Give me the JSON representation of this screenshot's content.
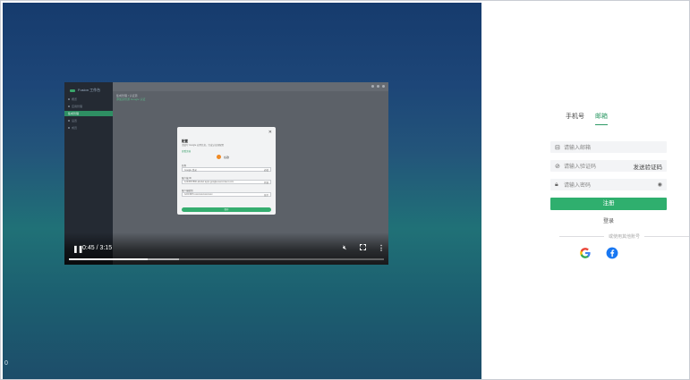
{
  "hero": {
    "corner_text": "0",
    "video": {
      "sidebar": {
        "logo": "Fusion 工作台",
        "items": [
          {
            "label": "概览"
          },
          {
            "label": "应用管理"
          },
          {
            "label": "集成管理",
            "selected": true
          },
          {
            "label": "设置"
          },
          {
            "label": "成员"
          }
        ]
      },
      "breadcrumb": {
        "title": "集成管理 / 认证源",
        "sub": "添加身份源 Google 认证"
      },
      "modal": {
        "title": "配置",
        "description": "请填写 Google 应用信息，完成认证源配置",
        "link": "查看文档",
        "badge": "谷歌",
        "fields": [
          {
            "label": "名称",
            "value": "Google 登录",
            "hint": "必填"
          },
          {
            "label": "客户端 ID",
            "value": "1234567890-abcdef.apps.googleusercontent.com",
            "hint": "复制"
          },
          {
            "label": "客户端密钥",
            "value": "GOCSPX-xxxxxxxxxxxxxxxx",
            "hint": "显示"
          }
        ],
        "submit": "保存"
      },
      "controls": {
        "time": "0:45 / 3:15",
        "played_fraction": 0.25,
        "buffered_fraction": 0.35
      }
    }
  },
  "form": {
    "tabs": [
      {
        "label": "手机号",
        "active": false
      },
      {
        "label": "邮箱",
        "active": true
      }
    ],
    "email_placeholder": "请输入邮箱",
    "code_placeholder": "请输入验证码",
    "send_code": "发送验证码",
    "password_placeholder": "请输入密码",
    "register": "注册",
    "login": "登录",
    "other_login": "或使用其他账号",
    "socials": [
      {
        "name": "google-icon"
      },
      {
        "name": "facebook-icon"
      }
    ],
    "colors": {
      "accent": "#2faf6e",
      "google_blue": "#4285F4",
      "facebook": "#1877F2"
    }
  }
}
